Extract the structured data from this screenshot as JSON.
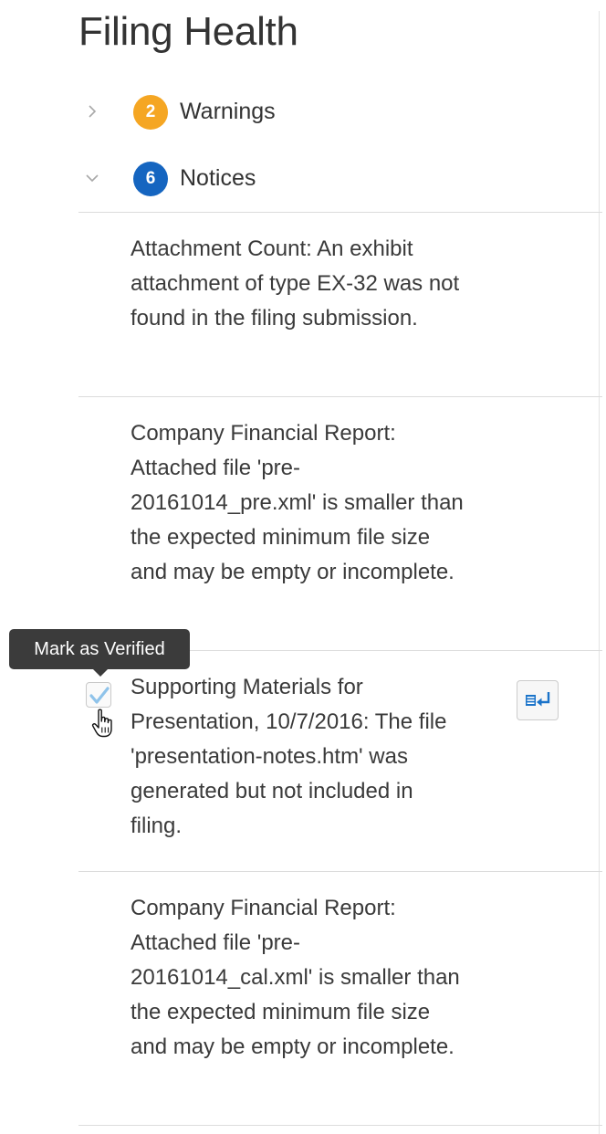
{
  "panel": {
    "title": "Filing Health"
  },
  "groups": [
    {
      "id": "warnings",
      "count": "2",
      "label": "Warnings",
      "expanded": false,
      "color": "#f5a623"
    },
    {
      "id": "notices",
      "count": "6",
      "label": "Notices",
      "expanded": true,
      "color": "#1565c0"
    }
  ],
  "notices": [
    {
      "text": "Attachment Count: An exhibit attachment of type EX-32 was not found in the filing submission."
    },
    {
      "text": "Company Financial Report: Attached file 'pre-20161014_pre.xml' is smaller than the expected minimum file size and may be empty or incomplete."
    },
    {
      "text": "Supporting Materials for Presentation, 10/7/2016: The file 'presentation-notes.htm' was generated but not included in filing."
    },
    {
      "text": "Company Financial Report: Attached file 'pre-20161014_cal.xml' is smaller than the expected minimum file size and may be empty or incomplete."
    }
  ],
  "tooltip": {
    "text": "Mark as Verified"
  },
  "icons": {
    "warnings_chevron": "chevron-right-icon",
    "notices_chevron": "chevron-down-icon",
    "verify": "checkmark-icon",
    "goto": "go-to-source-icon",
    "cursor": "hand-pointer-icon"
  },
  "colors": {
    "warning_badge": "#f5a623",
    "notice_badge": "#1565c0",
    "checkmark": "#8fc3ea",
    "tooltip_bg": "#3b3b3b",
    "goto_icon": "#1a73c9"
  }
}
